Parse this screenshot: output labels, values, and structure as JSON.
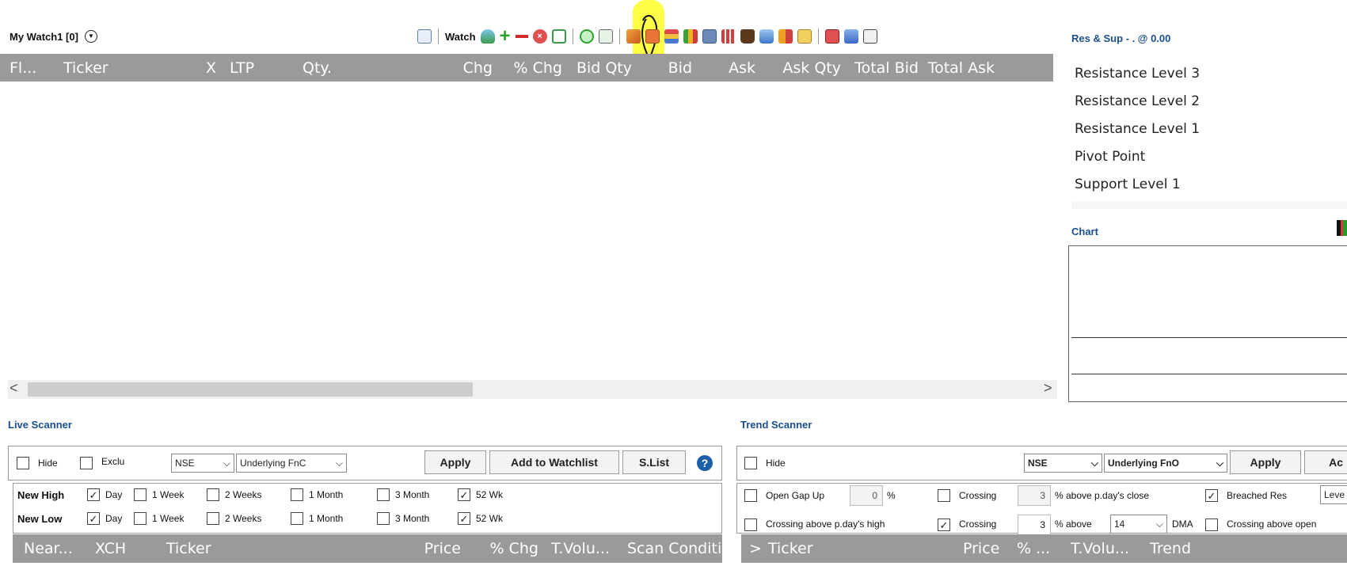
{
  "watch": {
    "title": "My Watch1 [0]",
    "toolbar_label": "Watch",
    "columns": [
      "Fl...",
      "Ticker",
      "X",
      "LTP",
      "Qty.",
      "Chg",
      "% Chg",
      "Bid Qty",
      "Bid",
      "Ask",
      "Ask Qty",
      "Total Bid",
      "Total Ask"
    ],
    "scroll_left": "<",
    "scroll_right": ">"
  },
  "toolbar_icons": [
    "calendar-icon",
    "watch-label",
    "bottle-icon",
    "plus-icon",
    "minus-icon",
    "cancel-icon",
    "monitor-icon",
    "refresh-icon",
    "export-icon",
    "pencil-icon",
    "grid-icon",
    "stack-icon",
    "bar-chart-icon",
    "printer-icon",
    "table-icon",
    "bag-icon",
    "jar-icon",
    "chart-icon",
    "notes-icon",
    "message-icon",
    "arrows-icon",
    "edit-icon"
  ],
  "res_sup": {
    "title": "Res & Sup - . @ 0.00",
    "levels": [
      "Resistance Level 3",
      "Resistance Level 2",
      "Resistance Level 1",
      "Pivot Point",
      "Support Level 1"
    ]
  },
  "chart": {
    "title": "Chart"
  },
  "live_scanner": {
    "title": "Live Scanner",
    "hide_label": "Hide",
    "exclu_label": "Exclu",
    "exchange": "NSE",
    "segment": "Underlying FnC",
    "apply": "Apply",
    "add_watchlist": "Add to Watchlist",
    "slist": "S.List",
    "help": "?",
    "new_high_label": "New High",
    "new_low_label": "New Low",
    "periods": [
      "Day",
      "1 Week",
      "2 Weeks",
      "1 Month",
      "3 Month",
      "52 Wk"
    ],
    "high_checked": [
      true,
      false,
      false,
      false,
      false,
      true
    ],
    "low_checked": [
      true,
      false,
      false,
      false,
      false,
      true
    ],
    "columns": [
      "Near...",
      "XCH",
      "Ticker",
      "Price",
      "% Chg",
      "T.Volu...",
      "Scan Condition"
    ]
  },
  "trend_scanner": {
    "title": "Trend Scanner",
    "hide_label": "Hide",
    "exchange": "NSE",
    "segment": "Underlying FnO",
    "apply": "Apply",
    "add_partial": "Ac",
    "open_gap_up": "Open Gap Up",
    "gap_value": "0",
    "pct": "%",
    "crossing_label": "Crossing",
    "cross_value1": "3",
    "above_close": "% above p.day's close",
    "breached_res": "Breached Res",
    "level_partial": "Leve",
    "crossing_high": "Crossing above p.day's high",
    "cross_value2": "3",
    "above_label": "% above",
    "dma_period": "14",
    "dma_label": "DMA",
    "crossing_open": "Crossing above open",
    "columns": [
      ">",
      "Ticker",
      "Price",
      "% ...",
      "T.Volu...",
      "Trend"
    ]
  }
}
